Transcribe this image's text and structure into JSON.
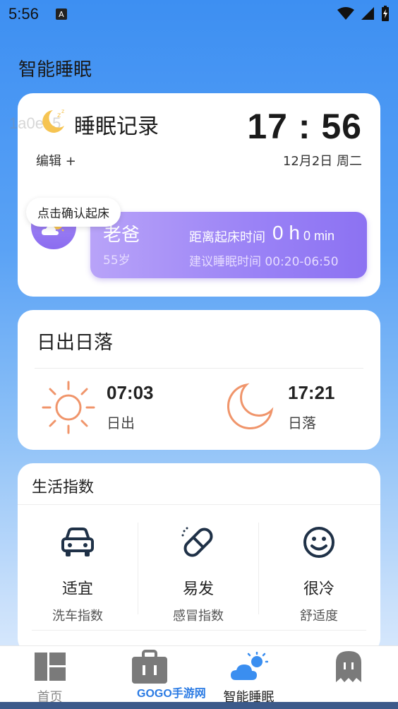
{
  "status_bar": {
    "time": "5:56",
    "notification_letter": "A"
  },
  "page_title": "智能睡眠",
  "sleep_card": {
    "watermark": "1a0e15",
    "title": "睡眠记录",
    "clock": "17 : 56",
    "edit_label": "编辑 +",
    "date": "12月2日 周二",
    "tooltip": "点击确认起床",
    "profile": {
      "name": "老爸",
      "age": "55岁",
      "wake_label": "距离起床时间",
      "wake_hours": "0 h",
      "wake_minutes": "0 min",
      "suggestion": "建议睡眠时间 00:20-06:50"
    }
  },
  "sun_card": {
    "title": "日出日落",
    "sunrise": {
      "time": "07:03",
      "label": "日出"
    },
    "sunset": {
      "time": "17:21",
      "label": "日落"
    }
  },
  "life_card": {
    "title": "生活指数",
    "items": [
      {
        "value": "适宜",
        "label": "洗车指数",
        "icon": "car-icon"
      },
      {
        "value": "易发",
        "label": "感冒指数",
        "icon": "pill-icon"
      },
      {
        "value": "很冷",
        "label": "舒适度",
        "icon": "smiley-icon"
      }
    ]
  },
  "tabbar": {
    "tabs": [
      {
        "label": "首页",
        "icon": "dashboard-icon"
      },
      {
        "label": "",
        "icon": "briefcase-icon"
      },
      {
        "label": "智能睡眠",
        "icon": "weather-cloud-icon"
      },
      {
        "label": "",
        "icon": "ghost-icon"
      }
    ]
  },
  "overlay_logo": "GOGO手游网",
  "colors": {
    "accent_purple": "#9a82f6",
    "icon_orange": "#f0956b",
    "icon_navy": "#1f3147",
    "tab_blue": "#3a8ef0"
  }
}
